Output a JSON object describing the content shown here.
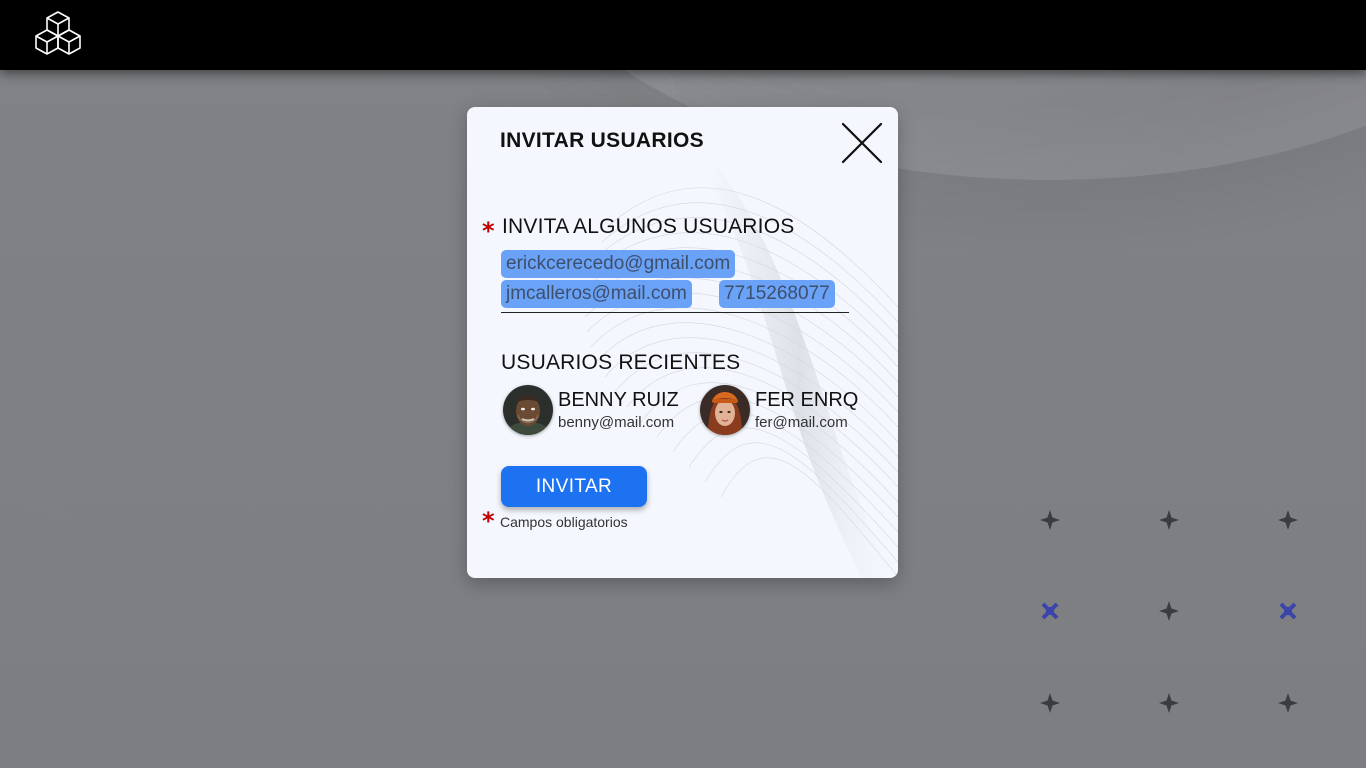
{
  "modal": {
    "title": "INVITAR USUARIOS",
    "invite_section": {
      "required_mark": "*",
      "label": "INVITA ALGUNOS USUARIOS",
      "chips": [
        "erickcerecedo@gmail.com",
        "jmcalleros@mail.com",
        "7715268077"
      ]
    },
    "recent_section": {
      "label": "USUARIOS RECIENTES",
      "users": [
        {
          "name": "BENNY RUIZ",
          "email": "benny@mail.com"
        },
        {
          "name": "FER ENRQ",
          "email": "fer@mail.com"
        }
      ]
    },
    "invite_button_label": "INVITAR",
    "required_note": {
      "mark": "*",
      "text": "Campos obligatorios"
    }
  },
  "icons": {
    "logo": "cubes-logo-icon",
    "close": "close-icon",
    "grid": "plus-icon"
  },
  "colors": {
    "topbar": "#000000",
    "modal_bg": "#f4f7fd",
    "chip_bg": "#6aa2f7",
    "chip_text": "#3e4f6c",
    "button_bg": "#1d72f2",
    "required": "#c00000",
    "grid_plus": "#3a3c40",
    "grid_x": "#3b44a8"
  }
}
